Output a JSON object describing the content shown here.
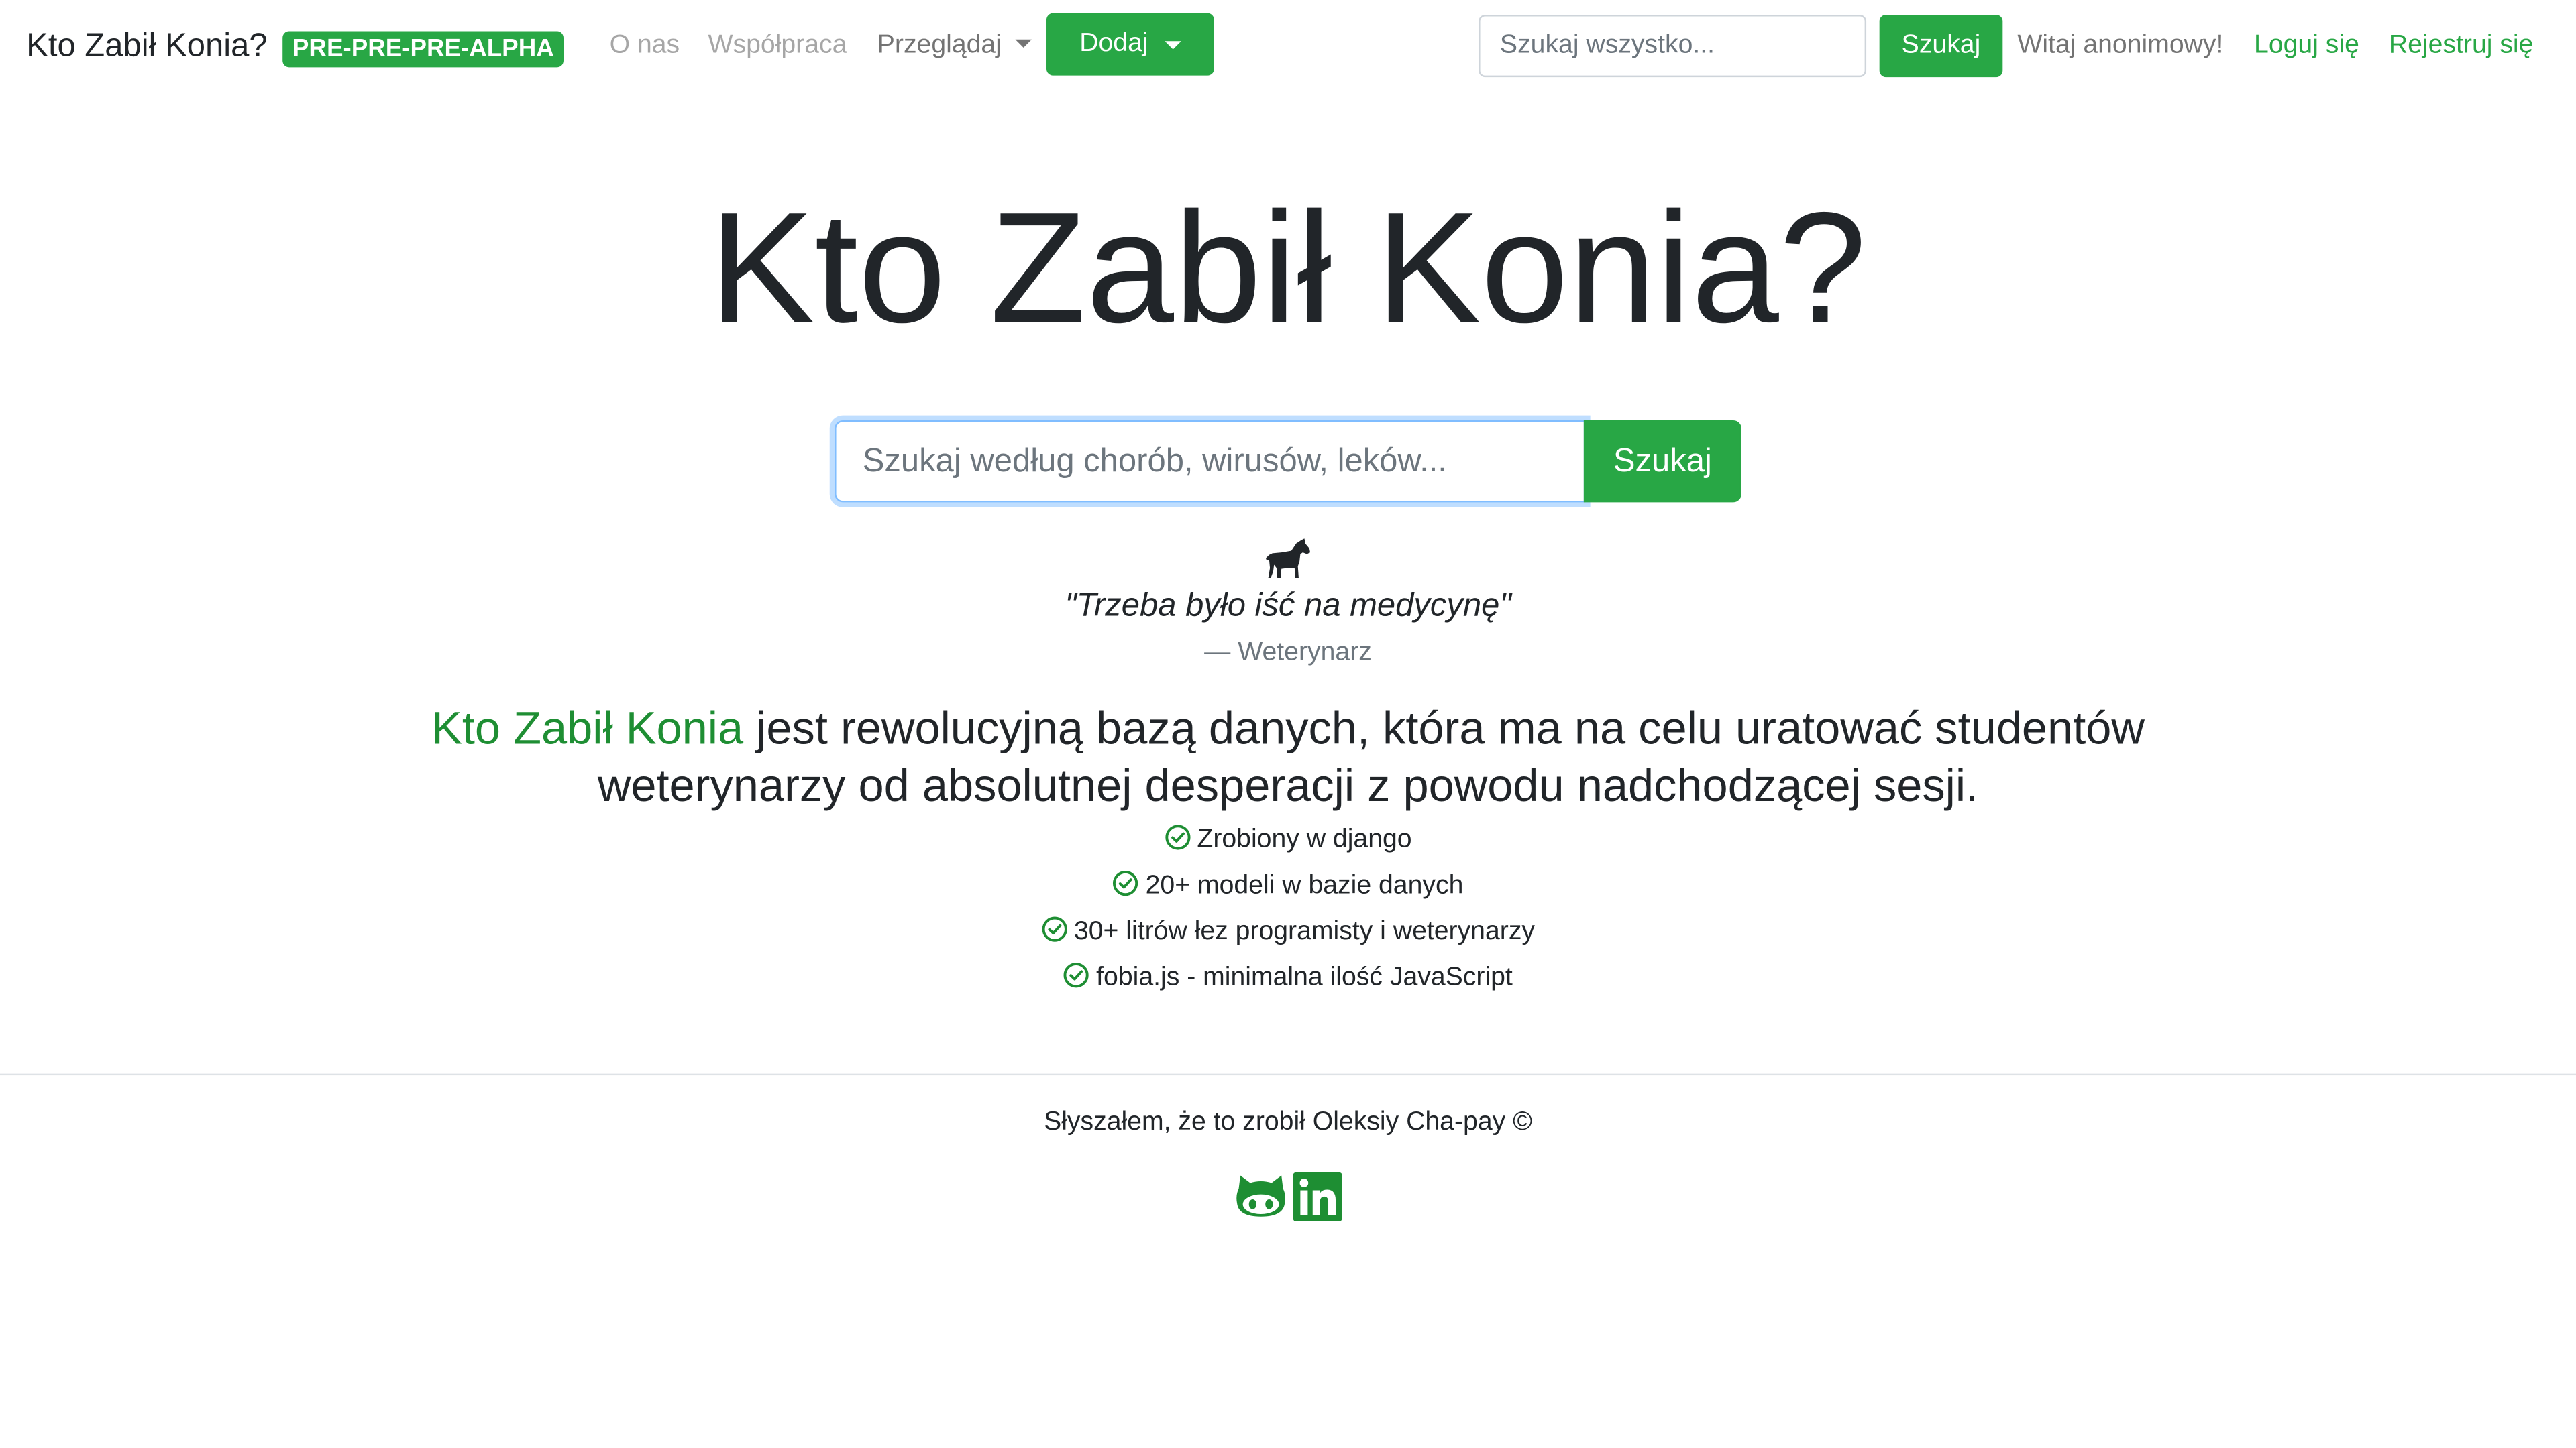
{
  "navbar": {
    "brand": "Kto Zabił Konia?",
    "badge": "PRE-PRE-PRE-ALPHA",
    "links": {
      "about": "O nas",
      "collab": "Współpraca",
      "browse": "Przeglądaj"
    },
    "add_button": "Dodaj",
    "search": {
      "placeholder": "Szukaj wszystko...",
      "value": "",
      "button": "Szukaj"
    },
    "welcome": "Witaj anonimowy!",
    "login": "Loguj się",
    "register": "Rejestruj się"
  },
  "hero": {
    "title": "Kto Zabił Konia?",
    "search": {
      "placeholder": "Szukaj według chorób, wirusów, leków...",
      "value": "",
      "button": "Szukaj"
    },
    "icon": "horse-icon",
    "quote": "\"Trzeba było iść na medycynę\"",
    "quote_author": "— Weterynarz",
    "lead_link": "Kto Zabił Konia",
    "lead_text": " jest rewolucyjną bazą danych, która ma na celu uratować studentów weterynarzy od absolutnej desperacji z powodu nadchodzącej sesji.",
    "features": [
      "Zrobiony w django",
      "20+ modeli w bazie danych",
      "30+ litrów łez programisty i weterynarzy",
      "fobia.js - minimalna ilość JavaScript"
    ]
  },
  "footer": {
    "text": "Słyszałem, że to zrobił Oleksiy Cha-pay ©",
    "icons": [
      "github-icon",
      "linkedin-icon"
    ]
  },
  "colors": {
    "accent": "#28a745",
    "link_green": "#1e8e33",
    "text": "#212529",
    "muted": "#6c757d"
  }
}
